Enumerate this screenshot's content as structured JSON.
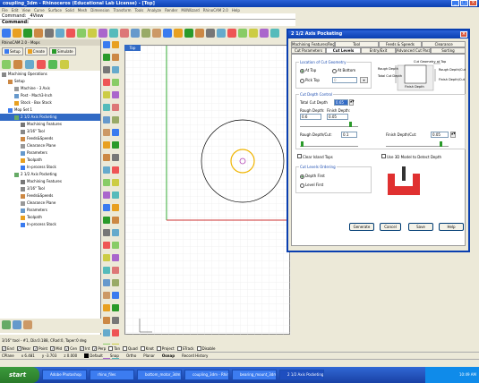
{
  "window": {
    "title": "coupling_3dm - Rhinoceros (Educational Lab License) - [Top]"
  },
  "menubar": {
    "items": [
      "File",
      "Edit",
      "View",
      "Curve",
      "Surface",
      "Solid",
      "Mesh",
      "Dimension",
      "Transform",
      "Tools",
      "Analyze",
      "Render",
      "MillWizard",
      "RhinoCAM 2.0",
      "Help"
    ]
  },
  "command": {
    "line1": "Command: _4View",
    "line2": "Command:"
  },
  "left_panel": {
    "title": "RhinoCAM 2.0 - Mops",
    "tabs": [
      "Setup",
      "Create",
      "Simulate"
    ],
    "tree": [
      {
        "label": "Machining Operations",
        "level": 0
      },
      {
        "label": "Setup",
        "level": 1
      },
      {
        "label": "Machine - 3 Axis",
        "level": 2
      },
      {
        "label": "Post - Mach3-Inch",
        "level": 2
      },
      {
        "label": "Stock - Box Stock",
        "level": 2
      },
      {
        "label": "Mop Set 1",
        "level": 1
      },
      {
        "label": "2 1/2 Axis Pocketing",
        "level": 2
      },
      {
        "label": "Machining Features",
        "level": 3
      },
      {
        "label": "3/16\" Tool",
        "level": 3
      },
      {
        "label": "Feeds&Speeds",
        "level": 3
      },
      {
        "label": "Clearance Plane",
        "level": 3
      },
      {
        "label": "Parameters",
        "level": 3
      },
      {
        "label": "Toolpath",
        "level": 3
      },
      {
        "label": "In-process Stock",
        "level": 3
      },
      {
        "label": "2 1/2 Axis Pocketing",
        "level": 2
      },
      {
        "label": "Machining Features",
        "level": 3
      },
      {
        "label": "3/16\" Tool",
        "level": 3
      },
      {
        "label": "Feeds&Speeds",
        "level": 3
      },
      {
        "label": "Clearance Plane",
        "level": 3
      },
      {
        "label": "Parameters",
        "level": 3
      },
      {
        "label": "Toolpath",
        "level": 3
      },
      {
        "label": "In-process Stock",
        "level": 3
      }
    ],
    "status": "3/16\" tool - #1, Dia:0.188, CRad:0, Taper:0 deg"
  },
  "viewport": {
    "label": "Top"
  },
  "osnap": {
    "items": [
      {
        "label": "End",
        "checked": true
      },
      {
        "label": "Near",
        "checked": true
      },
      {
        "label": "Point",
        "checked": true
      },
      {
        "label": "Mid",
        "checked": true
      },
      {
        "label": "Cen",
        "checked": true
      },
      {
        "label": "Int",
        "checked": true
      },
      {
        "label": "Perp",
        "checked": true
      },
      {
        "label": "Tan",
        "checked": false
      },
      {
        "label": "Quad",
        "checked": false
      },
      {
        "label": "Knot",
        "checked": false
      },
      {
        "label": "Project",
        "checked": false
      },
      {
        "label": "STrack",
        "checked": false
      },
      {
        "label": "Disable",
        "checked": false
      }
    ]
  },
  "statusbar": {
    "cplane": "CPlane",
    "x": "x 6.481",
    "y": "y -3.703",
    "z": "z 0.000",
    "layer": "Default",
    "snap": "Snap",
    "ortho": "Ortho",
    "planar": "Planar",
    "osnap": "Osnap",
    "history": "Record History"
  },
  "dialog": {
    "title": "2 1/2 Axis Pocketing",
    "tabs_row1": [
      "Machining Features/Regions",
      "Tool",
      "Feeds & Speeds",
      "Clearance"
    ],
    "tabs_row2": [
      "Cut Parameters",
      "Cut Levels",
      "Entry/Exit",
      "Advanced Cut Parameters",
      "Sorting"
    ],
    "location_group": "Location of Cut Geometry",
    "at_top": "At Top",
    "at_bottom": "At Bottom",
    "pick_top": "Pick Top",
    "pick_top_value": "0",
    "diagram": {
      "cut_geom": "Cut Geometry at Top",
      "rough_depth": "Rough Depth",
      "rough_depth_cut": "Rough Depth/Cut",
      "total_cut_depth": "Total Cut Depth",
      "finish_depth": "Finish Depth",
      "finish_depth_cut": "Finish Depth/Cut"
    },
    "depth_group": "Cut Depth Control",
    "total_cut_depth_label": "Total Cut Depth",
    "total_cut_depth_value": "0.65",
    "rough_depth_label": "Rough Depth:",
    "rough_depth_value": "0.6",
    "finish_depth_label": "Finish Depth:",
    "finish_depth_value": "0.05",
    "rough_depth_cut_label": "Rough Depth/Cut:",
    "rough_depth_cut_value": "0.1",
    "finish_depth_cut_label": "Finish Depth/Cut:",
    "finish_depth_cut_value": "0.05",
    "clear_island_tops": "Clear Island Tops",
    "use_3d_model": "Use 3D Model to Detect Depth",
    "ordering_group": "Cut Levels Ordering",
    "depth_first": "Depth First",
    "level_first": "Level First",
    "buttons": [
      "Generate",
      "Cancel",
      "Save",
      "Help"
    ]
  },
  "taskbar": {
    "start": "start",
    "tasks": [
      "Adobe Photoshop",
      "rhino_files",
      "bottom_motor_3dm",
      "coupling_3dm - Rhino...",
      "bearing_mount_3dm",
      "2 1/2 Axis Pocketing"
    ],
    "clock": "10:49 AM"
  }
}
